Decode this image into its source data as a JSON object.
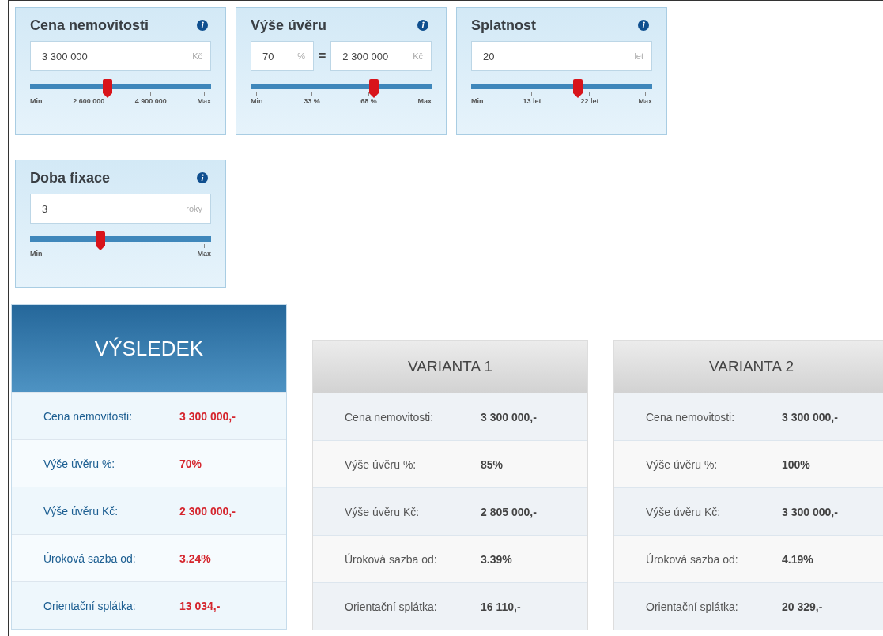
{
  "calculators": [
    {
      "title": "Cena nemovitosti",
      "inputs": [
        {
          "value": "3 300 000",
          "unit": "Kč"
        }
      ],
      "level": 0.43,
      "ticks": [
        "Min",
        "2 600 000",
        "4 900 000",
        "Max"
      ]
    },
    {
      "title": "Výše úvěru",
      "inputs": [
        {
          "value": "70",
          "unit": "%"
        },
        {
          "value": "2 300 000",
          "unit": "Kč"
        }
      ],
      "separator": "=",
      "level": 0.68,
      "ticks": [
        "Min",
        "33 %",
        "68 %",
        "Max"
      ]
    },
    {
      "title": "Splatnost",
      "inputs": [
        {
          "value": "20",
          "unit": "let"
        }
      ],
      "level": 0.59,
      "ticks": [
        "Min",
        "13 let",
        "22 let",
        "Max"
      ]
    },
    {
      "title": "Doba fixace",
      "inputs": [
        {
          "value": "3",
          "unit": "roky"
        }
      ],
      "level": 0.39,
      "ticks": [
        "Min",
        "Max"
      ]
    }
  ],
  "results": [
    {
      "kind": "primary",
      "title": "VÝSLEDEK",
      "rows": [
        {
          "label": "Cena nemovitosti:",
          "value": "3 300 000,-"
        },
        {
          "label": "Výše úvěru %:",
          "value": "70%"
        },
        {
          "label": "Výše úvěru Kč:",
          "value": "2 300 000,-"
        },
        {
          "label": "Úroková sazba od:",
          "value": "3.24%"
        },
        {
          "label": "Orientační splátka:",
          "value": "13 034,-"
        }
      ]
    },
    {
      "kind": "variant",
      "title": "VARIANTA 1",
      "rows": [
        {
          "label": "Cena nemovitosti:",
          "value": "3 300 000,-"
        },
        {
          "label": "Výše úvěru %:",
          "value": "85%"
        },
        {
          "label": "Výše úvěru Kč:",
          "value": "2 805 000,-"
        },
        {
          "label": "Úroková sazba od:",
          "value": "3.39%"
        },
        {
          "label": "Orientační splátka:",
          "value": "16 110,-"
        }
      ]
    },
    {
      "kind": "variant",
      "title": "VARIANTA 2",
      "rows": [
        {
          "label": "Cena nemovitosti:",
          "value": "3 300 000,-"
        },
        {
          "label": "Výše úvěru %:",
          "value": "100%"
        },
        {
          "label": "Výše úvěru Kč:",
          "value": "3 300 000,-"
        },
        {
          "label": "Úroková sazba od:",
          "value": "4.19%"
        },
        {
          "label": "Orientační splátka:",
          "value": "20 329,-"
        }
      ]
    }
  ]
}
